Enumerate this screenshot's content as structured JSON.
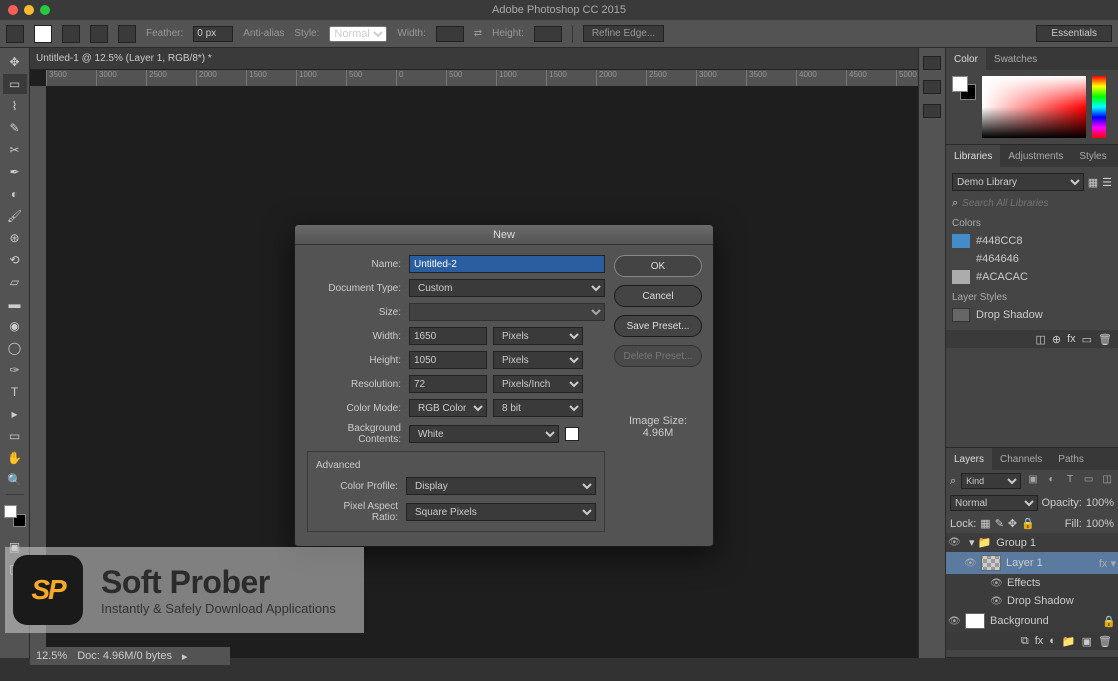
{
  "app_title": "Adobe Photoshop CC 2015",
  "workspace": "Essentials",
  "optbar": {
    "feather_label": "Feather:",
    "feather_value": "0 px",
    "antialias": "Anti-alias",
    "style_label": "Style:",
    "style_value": "Normal",
    "width_label": "Width:",
    "height_label": "Height:",
    "refine": "Refine Edge..."
  },
  "doc_tab": "Untitled-1 @ 12.5% (Layer 1, RGB/8*) *",
  "ruler_marks": [
    "3500",
    "3000",
    "2500",
    "2000",
    "1500",
    "1000",
    "500",
    "0",
    "500",
    "1000",
    "1500",
    "2000",
    "2500",
    "3000",
    "3500",
    "4000",
    "4500",
    "5000"
  ],
  "panels": {
    "color_tab": "Color",
    "swatches_tab": "Swatches",
    "libraries_tab": "Libraries",
    "adjustments_tab": "Adjustments",
    "styles_tab": "Styles",
    "library_name": "Demo Library",
    "search_placeholder": "Search All Libraries",
    "colors_header": "Colors",
    "colors": [
      {
        "hex": "#448CC8",
        "label": "#448CC8"
      },
      {
        "hex": "#464646",
        "label": "#464646"
      },
      {
        "hex": "#ACACAC",
        "label": "#ACACAC"
      }
    ],
    "layerstyles_header": "Layer Styles",
    "layerstyle_item": "Drop Shadow",
    "layers_tab": "Layers",
    "channels_tab": "Channels",
    "paths_tab": "Paths",
    "kind": "Kind",
    "blend": "Normal",
    "opacity_label": "Opacity:",
    "opacity_value": "100%",
    "lock_label": "Lock:",
    "fill_label": "Fill:",
    "fill_value": "100%",
    "group1": "Group 1",
    "layer1": "Layer 1",
    "effects": "Effects",
    "dropshadow": "Drop Shadow",
    "background": "Background"
  },
  "dialog": {
    "title": "New",
    "name_label": "Name:",
    "name_value": "Untitled-2",
    "doctype_label": "Document Type:",
    "doctype_value": "Custom",
    "size_label": "Size:",
    "width_label": "Width:",
    "width_value": "1650",
    "height_label": "Height:",
    "height_value": "1050",
    "unit_px": "Pixels",
    "res_label": "Resolution:",
    "res_value": "72",
    "res_unit": "Pixels/Inch",
    "cmode_label": "Color Mode:",
    "cmode_value": "RGB Color",
    "cdepth": "8 bit",
    "bg_label": "Background Contents:",
    "bg_value": "White",
    "advanced": "Advanced",
    "profile_label": "Color Profile:",
    "profile_value": "Display",
    "par_label": "Pixel Aspect Ratio:",
    "par_value": "Square Pixels",
    "ok": "OK",
    "cancel": "Cancel",
    "save_preset": "Save Preset...",
    "delete_preset": "Delete Preset...",
    "imgsize_label": "Image Size:",
    "imgsize_value": "4.96M"
  },
  "status": {
    "zoom": "12.5%",
    "doc": "Doc: 4.96M/0 bytes"
  },
  "watermark": {
    "brand": "SP",
    "title": "Soft Prober",
    "subtitle": "Instantly & Safely Download Applications"
  }
}
